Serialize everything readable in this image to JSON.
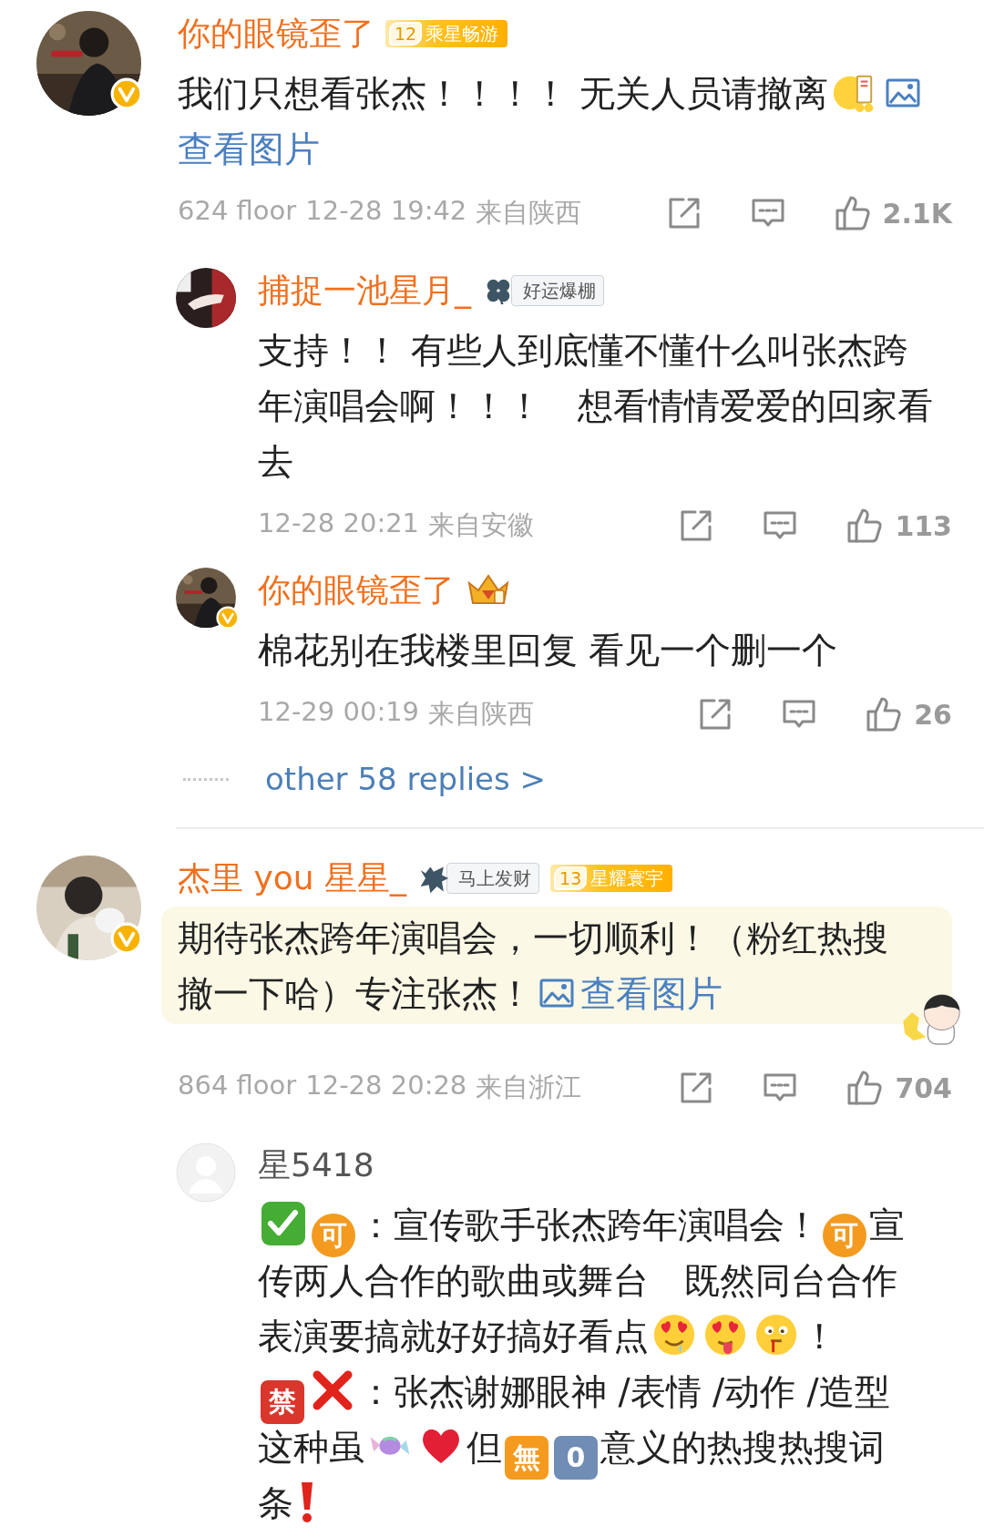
{
  "comments": [
    {
      "author": {
        "name": "你的眼镜歪了",
        "color": "#f0701e",
        "verified": true,
        "badges": [
          {
            "kind": "level",
            "level": "12",
            "text": "乘星畅游"
          }
        ]
      },
      "decorated": false,
      "body": [
        [
          {
            "kind": "text",
            "text": "我们只想看张杰！！！！ 无关人员请撤离"
          },
          {
            "kind": "ticketface"
          },
          {
            "kind": "imageicon"
          }
        ],
        [
          {
            "kind": "link",
            "text": "查看图片"
          }
        ]
      ],
      "floor": "624 floor",
      "time": "12-28 19:42",
      "location": "来自陕西",
      "likes": "2.1K",
      "replies": [
        {
          "author": {
            "name": "捕捉一池星月_",
            "color": "#f0701e",
            "verified": false,
            "badges": [
              {
                "kind": "clovertag",
                "text": "好运爆棚"
              }
            ]
          },
          "body": [
            [
              {
                "kind": "text",
                "text": "支持！！ 有些人到底懂不懂什么叫张杰跨"
              }
            ],
            [
              {
                "kind": "text",
                "text": "年演唱会啊！！！　想看情情爱爱的回家看"
              }
            ],
            [
              {
                "kind": "text",
                "text": "去"
              }
            ]
          ],
          "time": "12-28 20:21",
          "location": "来自安徽",
          "likes": "113"
        },
        {
          "author": {
            "name": "你的眼镜歪了",
            "color": "#f0701e",
            "verified": true,
            "badges": [
              {
                "kind": "crown"
              }
            ]
          },
          "body": [
            [
              {
                "kind": "text",
                "text": "棉花别在我楼里回复 看见一个删一个"
              }
            ]
          ],
          "time": "12-29 00:19",
          "location": "来自陕西",
          "likes": "26"
        }
      ],
      "more_replies": "other 58 replies >"
    },
    {
      "author": {
        "name": "杰里 you 星星_",
        "color": "#f0701e",
        "verified": true,
        "badges": [
          {
            "kind": "horsetag",
            "text": "马上发财"
          },
          {
            "kind": "level",
            "level": "13",
            "text": "星耀寰宇"
          }
        ]
      },
      "decorated": true,
      "body": [
        [
          {
            "kind": "text",
            "text": "期待张杰跨年演唱会，一切顺利！（粉红热搜"
          }
        ],
        [
          {
            "kind": "text",
            "text": "撤一下哈）专注张杰！"
          },
          {
            "kind": "imageicon"
          },
          {
            "kind": "link",
            "text": "查看图片"
          }
        ]
      ],
      "floor": "864 floor",
      "time": "12-28 20:28",
      "location": "来自浙江",
      "likes": "704",
      "replies": [
        {
          "author": {
            "name": "星5418",
            "color": "#555555",
            "verified": false
          },
          "body": [
            [
              {
                "kind": "check"
              },
              {
                "kind": "circletag",
                "text": "可",
                "color": "#f39a1f"
              },
              {
                "kind": "text",
                "text": "：宣传歌手张杰跨年演唱会！"
              },
              {
                "kind": "circletag",
                "text": "可",
                "color": "#f39a1f"
              },
              {
                "kind": "text",
                "text": "宣"
              }
            ],
            [
              {
                "kind": "text",
                "text": "传两人合作的歌曲或舞台　既然同台合作"
              }
            ],
            [
              {
                "kind": "text",
                "text": "表演要搞就好好搞好看点"
              },
              {
                "kind": "droolface"
              },
              {
                "kind": "tongueface"
              },
              {
                "kind": "bleedface"
              },
              {
                "kind": "text",
                "text": "！"
              }
            ],
            [
              {
                "kind": "squaretag",
                "text": "禁",
                "color": "#d9372c"
              },
              {
                "kind": "cross"
              },
              {
                "kind": "text",
                "text": "：张杰谢娜眼神 /表情 /动作 /造型"
              }
            ],
            [
              {
                "kind": "text",
                "text": "这种虽"
              },
              {
                "kind": "candy"
              },
              {
                "kind": "heart"
              },
              {
                "kind": "text",
                "text": "但"
              },
              {
                "kind": "squaretag",
                "text": "無",
                "color": "#f39a1f"
              },
              {
                "kind": "squaretag",
                "text": "0",
                "color": "#6f8db5"
              },
              {
                "kind": "text",
                "text": "意义的热搜热搜词"
              }
            ],
            [
              {
                "kind": "text",
                "text": "条"
              },
              {
                "kind": "exclaim"
              }
            ]
          ]
        }
      ]
    }
  ]
}
